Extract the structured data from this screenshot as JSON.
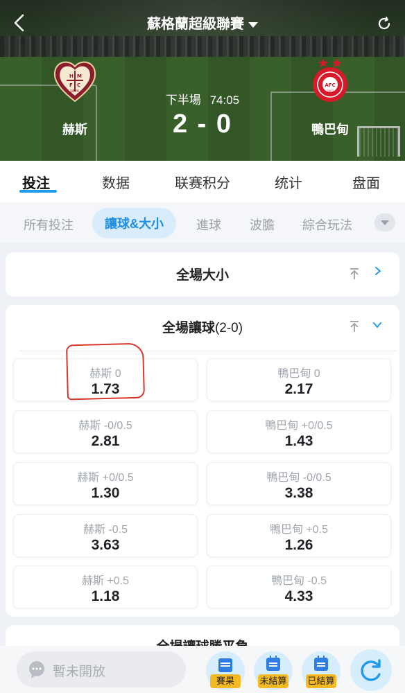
{
  "header": {
    "league_title": "蘇格蘭超級聯賽",
    "home_team": "赫斯",
    "away_team": "鴨巴甸",
    "period": "下半場",
    "match_clock": "74:05",
    "score": "2 - 0",
    "home_logo_text": "H M F C 1874",
    "away_logo_text": "ABERDEEN FOOTBALL CLUB 1903"
  },
  "tabs": [
    {
      "label": "投注",
      "active": true
    },
    {
      "label": "数据"
    },
    {
      "label": "联赛积分"
    },
    {
      "label": "统计"
    },
    {
      "label": "盘面"
    }
  ],
  "subtabs": [
    {
      "label": "所有投注"
    },
    {
      "label": "讓球&大小",
      "active": true
    },
    {
      "label": "進球"
    },
    {
      "label": "波膽"
    },
    {
      "label": "綜合玩法"
    }
  ],
  "cards": {
    "total_goals": {
      "title": "全場大小",
      "collapsed": true
    },
    "handicap": {
      "title": "全場讓球",
      "title_suffix": "(2-0)",
      "expanded": true,
      "rows": [
        {
          "home_label": "赫斯 0",
          "home_odd": "1.73",
          "away_label": "鴨巴甸 0",
          "away_odd": "2.17"
        },
        {
          "home_label": "赫斯 -0/0.5",
          "home_odd": "2.81",
          "away_label": "鴨巴甸 +0/0.5",
          "away_odd": "1.43"
        },
        {
          "home_label": "赫斯 +0/0.5",
          "home_odd": "1.30",
          "away_label": "鴨巴甸 -0/0.5",
          "away_odd": "3.38"
        },
        {
          "home_label": "赫斯 -0.5",
          "home_odd": "3.63",
          "away_label": "鴨巴甸 +0.5",
          "away_odd": "1.26"
        },
        {
          "home_label": "赫斯 +0.5",
          "home_odd": "1.18",
          "away_label": "鴨巴甸 -0.5",
          "away_odd": "4.33"
        }
      ]
    },
    "next_card_title": "全場讓球勝平負"
  },
  "bottom_bar": {
    "input_placeholder": "暫未開放",
    "buttons": [
      {
        "label": "賽果",
        "icon": "results-icon"
      },
      {
        "label": "未結算",
        "icon": "unsettled-icon"
      },
      {
        "label": "已結算",
        "icon": "settled-icon"
      }
    ]
  },
  "colors": {
    "accent": "#1f9bea",
    "badge": "#f5b924",
    "highlight_annotation": "#d9372b"
  }
}
